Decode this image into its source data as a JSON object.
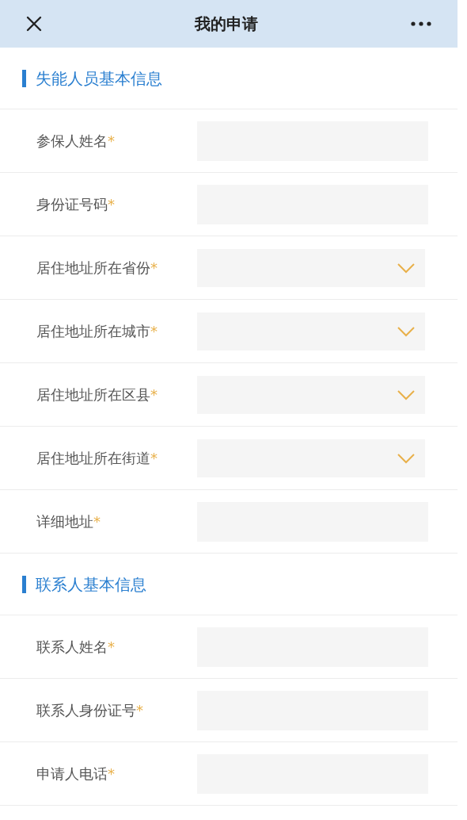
{
  "header": {
    "title": "我的申请"
  },
  "sections": [
    {
      "title": "失能人员基本信息",
      "fields": [
        {
          "label": "参保人姓名",
          "mark": "*",
          "kind": "text"
        },
        {
          "label": "身份证号码",
          "mark": "*",
          "kind": "text"
        },
        {
          "label": "居住地址所在省份",
          "mark": "*",
          "kind": "select"
        },
        {
          "label": "居住地址所在城市",
          "mark": "*",
          "kind": "select"
        },
        {
          "label": "居住地址所在区县",
          "mark": "*",
          "kind": "select"
        },
        {
          "label": "居住地址所在街道",
          "mark": "*",
          "kind": "select"
        },
        {
          "label": "详细地址",
          "mark": "*",
          "kind": "text"
        }
      ]
    },
    {
      "title": "联系人基本信息",
      "fields": [
        {
          "label": "联系人姓名",
          "mark": "*",
          "kind": "text"
        },
        {
          "label": "联系人身份证号",
          "mark": "*",
          "kind": "text"
        },
        {
          "label": "申请人电话",
          "mark": "*",
          "kind": "text"
        }
      ]
    }
  ]
}
